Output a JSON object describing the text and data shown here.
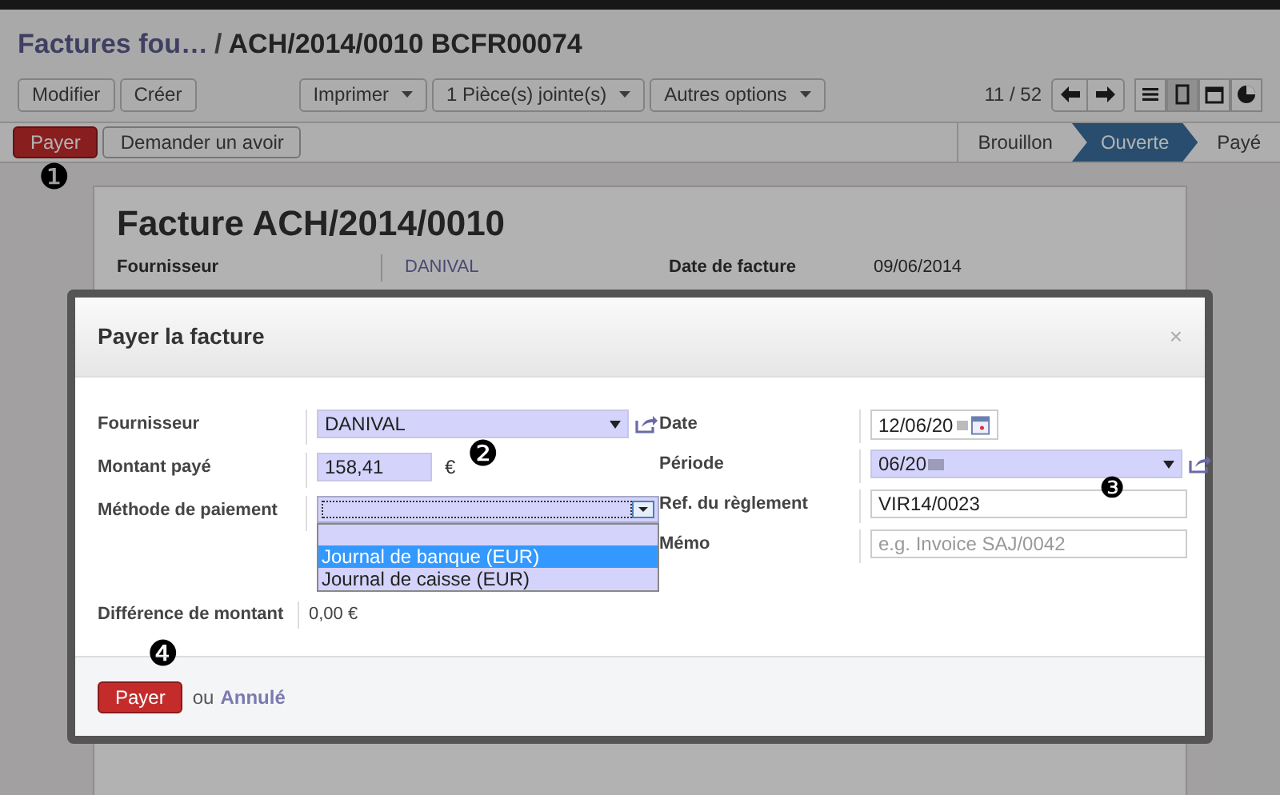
{
  "breadcrumb": {
    "parent": "Factures fou…",
    "separator": "/",
    "current": "ACH/2014/0010 BCFR00074"
  },
  "toolbar": {
    "left_buttons": [
      "Modifier",
      "Créer"
    ],
    "menus": [
      "Imprimer",
      "1 Pièce(s) jointe(s)",
      "Autres options"
    ],
    "pager": "11 / 52",
    "views": [
      {
        "kind": "list",
        "selected": false
      },
      {
        "kind": "form",
        "selected": true
      },
      {
        "kind": "calendar",
        "selected": false
      },
      {
        "kind": "graph",
        "selected": false
      }
    ]
  },
  "actions": {
    "primary": "Payer",
    "secondary": "Demander un avoir"
  },
  "status_steps": [
    {
      "label": "Brouillon",
      "selected": false
    },
    {
      "label": "Ouverte",
      "selected": true
    },
    {
      "label": "Payé",
      "selected": false
    }
  ],
  "sheet": {
    "title": "Facture ACH/2014/0010",
    "fields": [
      {
        "label": "Fournisseur",
        "value": "DANIVAL"
      },
      {
        "label": "Date de facture",
        "value": "09/06/2014"
      }
    ]
  },
  "dialog": {
    "title": "Payer la facture",
    "close": "×",
    "left": [
      {
        "label": "Fournisseur",
        "kind": "select",
        "value": "DANIVAL"
      },
      {
        "label": "Montant payé",
        "kind": "amount",
        "value": "158,41",
        "unit": "€"
      },
      {
        "label": "Méthode de paiement",
        "kind": "dropdown",
        "options": [
          {
            "label": "Journal de banque (EUR)",
            "selected": true
          },
          {
            "label": "Journal de caisse (EUR)",
            "selected": false
          }
        ]
      }
    ],
    "right": [
      {
        "label": "Date",
        "kind": "date",
        "value": "12/06/20"
      },
      {
        "label": "Période",
        "kind": "select",
        "value": "06/20"
      },
      {
        "label": "Ref. du règlement",
        "kind": "text",
        "value": "VIR14/0023"
      },
      {
        "label": "Mémo",
        "kind": "text",
        "placeholder": "e.g. Invoice SAJ/0042"
      }
    ],
    "difference": {
      "label": "Différence de montant",
      "value": "0,00 €"
    },
    "footer": {
      "button": "Payer",
      "or": "ou",
      "cancel": "Annulé"
    }
  },
  "markers": [
    "❶",
    "❷",
    "❸",
    "❹"
  ]
}
